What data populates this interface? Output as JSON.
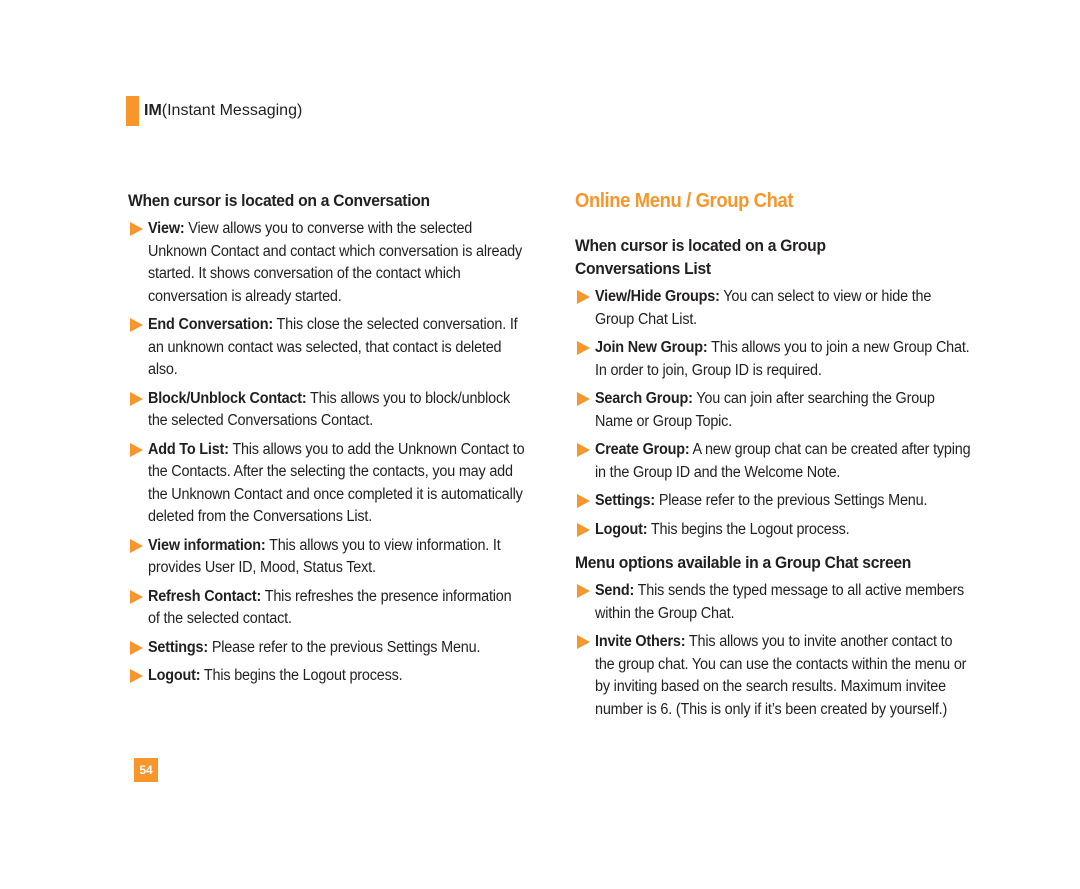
{
  "header": {
    "section_bold": "IM",
    "section_rest": "(Instant Messaging)"
  },
  "left": {
    "title": "When cursor is located on a Conversation",
    "items": [
      {
        "term": "View:",
        "text": " View allows you to converse with the selected Unknown Contact and contact which conversation is already started. It shows conversation of the contact which conversation is already started."
      },
      {
        "term": "End Conversation:",
        "text": " This close the selected conversation. If an unknown contact was selected, that contact is deleted also."
      },
      {
        "term": "Block/Unblock Contact:",
        "text": " This allows you to block/unblock the selected Conversations Contact."
      },
      {
        "term": "Add To List:",
        "text": " This allows you to add the Unknown Contact to the Contacts. After the selecting the contacts, you may add the Unknown Contact and once completed it is automatically deleted from the Conversations List."
      },
      {
        "term": "View information:",
        "text": " This allows you to view information. It provides User ID, Mood, Status Text."
      },
      {
        "term": "Refresh Contact:",
        "text": " This refreshes the presence information of the selected contact."
      },
      {
        "term": "Settings:",
        "text": " Please refer to the previous Settings Menu."
      },
      {
        "term": "Logout:",
        "text": " This begins the Logout process."
      }
    ]
  },
  "right": {
    "heading": "Online Menu / Group Chat",
    "section1": {
      "title": "When cursor is located on a Group Conversations List",
      "items": [
        {
          "term": "View/Hide Groups:",
          "text": " You can select to view or hide the Group Chat List."
        },
        {
          "term": "Join New Group:",
          "text": " This allows you to join a new Group Chat. In order to join, Group ID is required."
        },
        {
          "term": "Search Group:",
          "text": " You can join after searching the Group Name or Group Topic."
        },
        {
          "term": "Create Group:",
          "text": " A new group chat can be created after typing in the Group ID and the Welcome Note."
        },
        {
          "term": "Settings:",
          "text": " Please refer to the previous Settings Menu."
        },
        {
          "term": "Logout:",
          "text": " This begins the Logout process."
        }
      ]
    },
    "section2": {
      "title": "Menu options available in a Group Chat screen",
      "items": [
        {
          "term": "Send:",
          "text": " This sends the typed message to all active members within the Group Chat."
        },
        {
          "term": "Invite Others:",
          "text": " This allows you to invite another contact to the group chat. You can use the contacts within the menu or by inviting based on the search results. Maximum invitee number is 6. (This is only if it’s been created by yourself.)"
        }
      ]
    }
  },
  "footer": {
    "page_number": "54"
  },
  "colors": {
    "accent": "#f7962b",
    "text": "#231f20"
  }
}
